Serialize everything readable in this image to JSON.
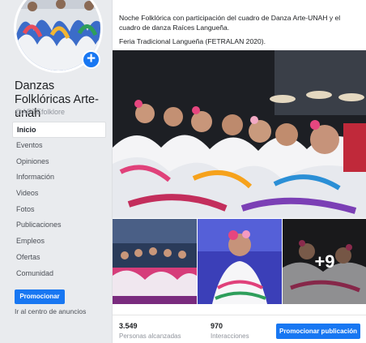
{
  "sidebar": {
    "page_name": "Danzas Folklóricas Arte-unah",
    "handle": "@ARTEfolklore",
    "add_icon": "+",
    "items": [
      {
        "label": "Inicio",
        "active": true
      },
      {
        "label": "Eventos"
      },
      {
        "label": "Opiniones"
      },
      {
        "label": "Información"
      },
      {
        "label": "Videos"
      },
      {
        "label": "Fotos"
      },
      {
        "label": "Publicaciones"
      },
      {
        "label": "Empleos"
      },
      {
        "label": "Ofertas"
      },
      {
        "label": "Comunidad"
      }
    ],
    "promote_label": "Promocionar",
    "ads_center_label": "Ir al centro de anuncios"
  },
  "post": {
    "line1": "Noche Folklórica con participación del cuadro de Danza Arte-UNAH y el cuadro de danza Raíces Langueña.",
    "line2": "Feria Tradicional Langueña (FETRALAN 2020).",
    "more_photos": "+9"
  },
  "stats": {
    "reach_value": "3.549",
    "reach_label": "Personas alcanzadas",
    "interactions_value": "970",
    "interactions_label": "Interacciones",
    "boost_label": "Promocionar publicación"
  },
  "colors": {
    "accent": "#1877f2",
    "background": "#e9ebee"
  }
}
